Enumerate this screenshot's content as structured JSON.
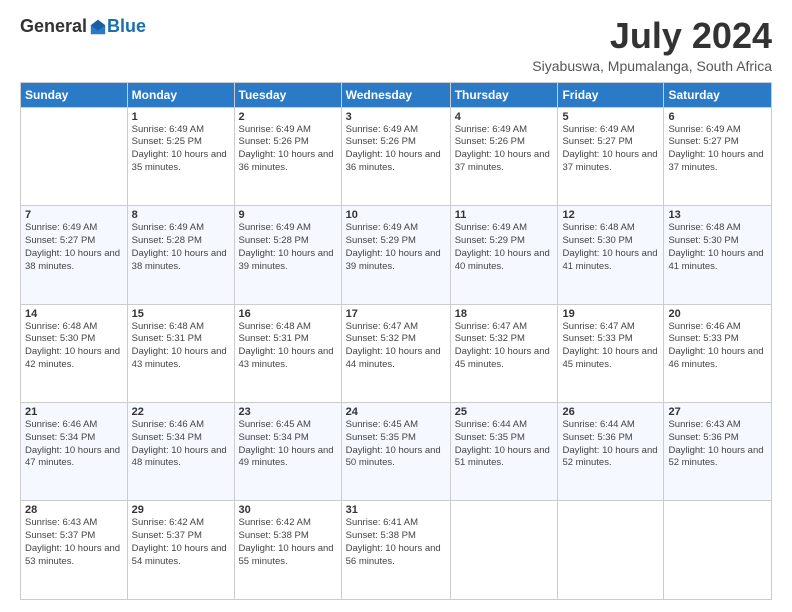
{
  "logo": {
    "general": "General",
    "blue": "Blue"
  },
  "header": {
    "month_year": "July 2024",
    "location": "Siyabuswa, Mpumalanga, South Africa"
  },
  "columns": [
    "Sunday",
    "Monday",
    "Tuesday",
    "Wednesday",
    "Thursday",
    "Friday",
    "Saturday"
  ],
  "weeks": [
    [
      {
        "day": "",
        "sunrise": "",
        "sunset": "",
        "daylight": ""
      },
      {
        "day": "1",
        "sunrise": "Sunrise: 6:49 AM",
        "sunset": "Sunset: 5:25 PM",
        "daylight": "Daylight: 10 hours and 35 minutes."
      },
      {
        "day": "2",
        "sunrise": "Sunrise: 6:49 AM",
        "sunset": "Sunset: 5:26 PM",
        "daylight": "Daylight: 10 hours and 36 minutes."
      },
      {
        "day": "3",
        "sunrise": "Sunrise: 6:49 AM",
        "sunset": "Sunset: 5:26 PM",
        "daylight": "Daylight: 10 hours and 36 minutes."
      },
      {
        "day": "4",
        "sunrise": "Sunrise: 6:49 AM",
        "sunset": "Sunset: 5:26 PM",
        "daylight": "Daylight: 10 hours and 37 minutes."
      },
      {
        "day": "5",
        "sunrise": "Sunrise: 6:49 AM",
        "sunset": "Sunset: 5:27 PM",
        "daylight": "Daylight: 10 hours and 37 minutes."
      },
      {
        "day": "6",
        "sunrise": "Sunrise: 6:49 AM",
        "sunset": "Sunset: 5:27 PM",
        "daylight": "Daylight: 10 hours and 37 minutes."
      }
    ],
    [
      {
        "day": "7",
        "sunrise": "Sunrise: 6:49 AM",
        "sunset": "Sunset: 5:27 PM",
        "daylight": "Daylight: 10 hours and 38 minutes."
      },
      {
        "day": "8",
        "sunrise": "Sunrise: 6:49 AM",
        "sunset": "Sunset: 5:28 PM",
        "daylight": "Daylight: 10 hours and 38 minutes."
      },
      {
        "day": "9",
        "sunrise": "Sunrise: 6:49 AM",
        "sunset": "Sunset: 5:28 PM",
        "daylight": "Daylight: 10 hours and 39 minutes."
      },
      {
        "day": "10",
        "sunrise": "Sunrise: 6:49 AM",
        "sunset": "Sunset: 5:29 PM",
        "daylight": "Daylight: 10 hours and 39 minutes."
      },
      {
        "day": "11",
        "sunrise": "Sunrise: 6:49 AM",
        "sunset": "Sunset: 5:29 PM",
        "daylight": "Daylight: 10 hours and 40 minutes."
      },
      {
        "day": "12",
        "sunrise": "Sunrise: 6:48 AM",
        "sunset": "Sunset: 5:30 PM",
        "daylight": "Daylight: 10 hours and 41 minutes."
      },
      {
        "day": "13",
        "sunrise": "Sunrise: 6:48 AM",
        "sunset": "Sunset: 5:30 PM",
        "daylight": "Daylight: 10 hours and 41 minutes."
      }
    ],
    [
      {
        "day": "14",
        "sunrise": "Sunrise: 6:48 AM",
        "sunset": "Sunset: 5:30 PM",
        "daylight": "Daylight: 10 hours and 42 minutes."
      },
      {
        "day": "15",
        "sunrise": "Sunrise: 6:48 AM",
        "sunset": "Sunset: 5:31 PM",
        "daylight": "Daylight: 10 hours and 43 minutes."
      },
      {
        "day": "16",
        "sunrise": "Sunrise: 6:48 AM",
        "sunset": "Sunset: 5:31 PM",
        "daylight": "Daylight: 10 hours and 43 minutes."
      },
      {
        "day": "17",
        "sunrise": "Sunrise: 6:47 AM",
        "sunset": "Sunset: 5:32 PM",
        "daylight": "Daylight: 10 hours and 44 minutes."
      },
      {
        "day": "18",
        "sunrise": "Sunrise: 6:47 AM",
        "sunset": "Sunset: 5:32 PM",
        "daylight": "Daylight: 10 hours and 45 minutes."
      },
      {
        "day": "19",
        "sunrise": "Sunrise: 6:47 AM",
        "sunset": "Sunset: 5:33 PM",
        "daylight": "Daylight: 10 hours and 45 minutes."
      },
      {
        "day": "20",
        "sunrise": "Sunrise: 6:46 AM",
        "sunset": "Sunset: 5:33 PM",
        "daylight": "Daylight: 10 hours and 46 minutes."
      }
    ],
    [
      {
        "day": "21",
        "sunrise": "Sunrise: 6:46 AM",
        "sunset": "Sunset: 5:34 PM",
        "daylight": "Daylight: 10 hours and 47 minutes."
      },
      {
        "day": "22",
        "sunrise": "Sunrise: 6:46 AM",
        "sunset": "Sunset: 5:34 PM",
        "daylight": "Daylight: 10 hours and 48 minutes."
      },
      {
        "day": "23",
        "sunrise": "Sunrise: 6:45 AM",
        "sunset": "Sunset: 5:34 PM",
        "daylight": "Daylight: 10 hours and 49 minutes."
      },
      {
        "day": "24",
        "sunrise": "Sunrise: 6:45 AM",
        "sunset": "Sunset: 5:35 PM",
        "daylight": "Daylight: 10 hours and 50 minutes."
      },
      {
        "day": "25",
        "sunrise": "Sunrise: 6:44 AM",
        "sunset": "Sunset: 5:35 PM",
        "daylight": "Daylight: 10 hours and 51 minutes."
      },
      {
        "day": "26",
        "sunrise": "Sunrise: 6:44 AM",
        "sunset": "Sunset: 5:36 PM",
        "daylight": "Daylight: 10 hours and 52 minutes."
      },
      {
        "day": "27",
        "sunrise": "Sunrise: 6:43 AM",
        "sunset": "Sunset: 5:36 PM",
        "daylight": "Daylight: 10 hours and 52 minutes."
      }
    ],
    [
      {
        "day": "28",
        "sunrise": "Sunrise: 6:43 AM",
        "sunset": "Sunset: 5:37 PM",
        "daylight": "Daylight: 10 hours and 53 minutes."
      },
      {
        "day": "29",
        "sunrise": "Sunrise: 6:42 AM",
        "sunset": "Sunset: 5:37 PM",
        "daylight": "Daylight: 10 hours and 54 minutes."
      },
      {
        "day": "30",
        "sunrise": "Sunrise: 6:42 AM",
        "sunset": "Sunset: 5:38 PM",
        "daylight": "Daylight: 10 hours and 55 minutes."
      },
      {
        "day": "31",
        "sunrise": "Sunrise: 6:41 AM",
        "sunset": "Sunset: 5:38 PM",
        "daylight": "Daylight: 10 hours and 56 minutes."
      },
      {
        "day": "",
        "sunrise": "",
        "sunset": "",
        "daylight": ""
      },
      {
        "day": "",
        "sunrise": "",
        "sunset": "",
        "daylight": ""
      },
      {
        "day": "",
        "sunrise": "",
        "sunset": "",
        "daylight": ""
      }
    ]
  ]
}
